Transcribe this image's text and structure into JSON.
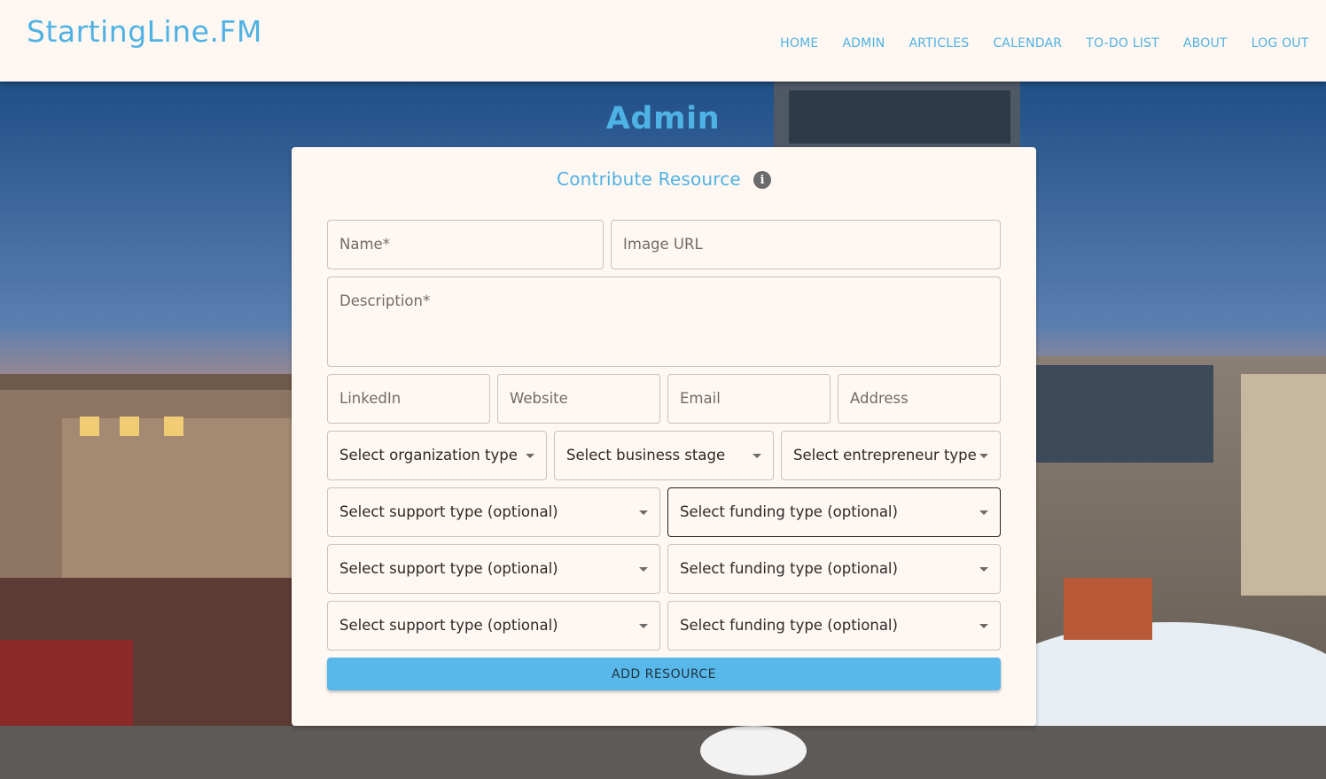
{
  "brand": "StartingLine.FM",
  "nav": [
    "HOME",
    "ADMIN",
    "ARTICLES",
    "CALENDAR",
    "TO-DO LIST",
    "ABOUT",
    "LOG OUT"
  ],
  "page_title": "Admin",
  "form": {
    "title": "Contribute Resource",
    "name_placeholder": "Name*",
    "image_url_placeholder": "Image URL",
    "description_placeholder": "Description*",
    "linkedin_placeholder": "LinkedIn",
    "website_placeholder": "Website",
    "email_placeholder": "Email",
    "address_placeholder": "Address",
    "organization_type": "Select organization type",
    "business_stage": "Select business stage",
    "entrepreneur_type": "Select entrepreneur type",
    "support_type": "Select support type (optional)",
    "funding_type": "Select funding type (optional)",
    "submit_label": "ADD RESOURCE"
  },
  "colors": {
    "accent": "#4fb2e4",
    "button": "#58b8ea",
    "surface": "#fff7f1"
  }
}
